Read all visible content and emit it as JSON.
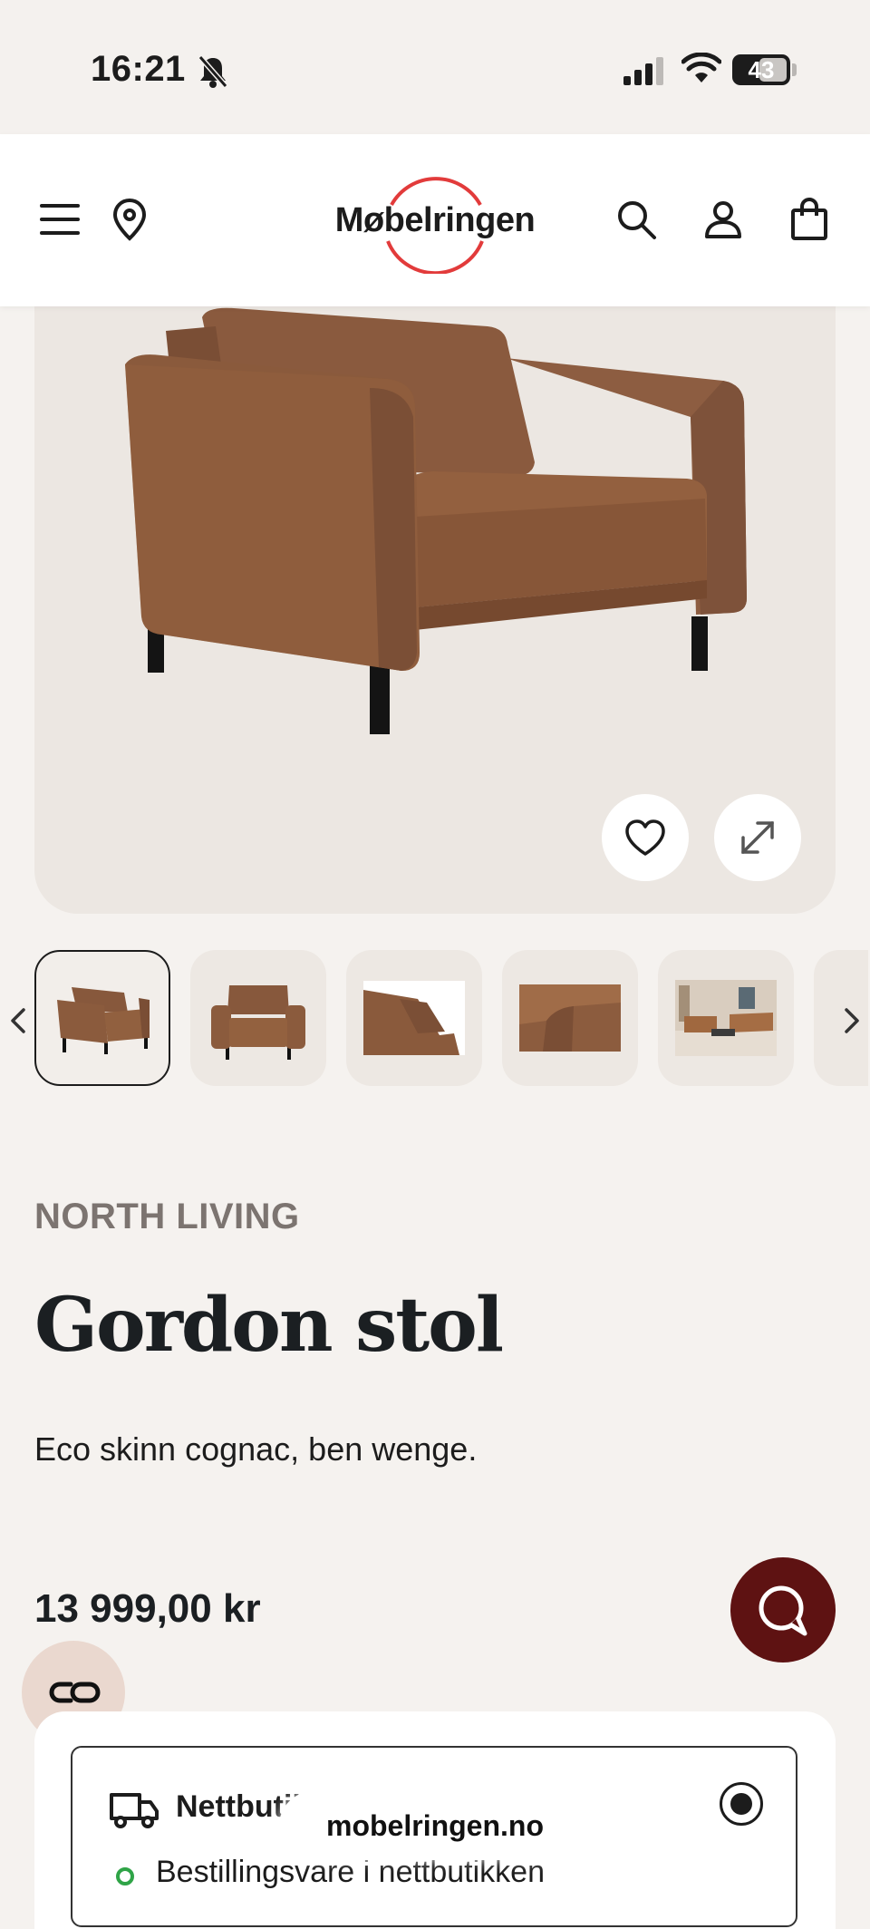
{
  "status_bar": {
    "time": "16:21",
    "battery": "43"
  },
  "header": {
    "logo_text": "Møbelringen"
  },
  "product": {
    "brand": "NORTH LIVING",
    "title": "Gordon stol",
    "description": "Eco skinn cognac, ben wenge.",
    "price": "13 999,00 kr",
    "thumbnails_count_visible": 5,
    "selected_thumbnail": 1
  },
  "delivery": {
    "option_title": "Nettbutikk",
    "availability": "Bestillingsvare i nettbutikken",
    "selected": true
  },
  "browser": {
    "url": "mobelringen.no"
  },
  "colors": {
    "accent": "#e23b3b",
    "chat_button": "#5e1212",
    "availability": "#2fa447",
    "background": "#f5f2ef"
  }
}
